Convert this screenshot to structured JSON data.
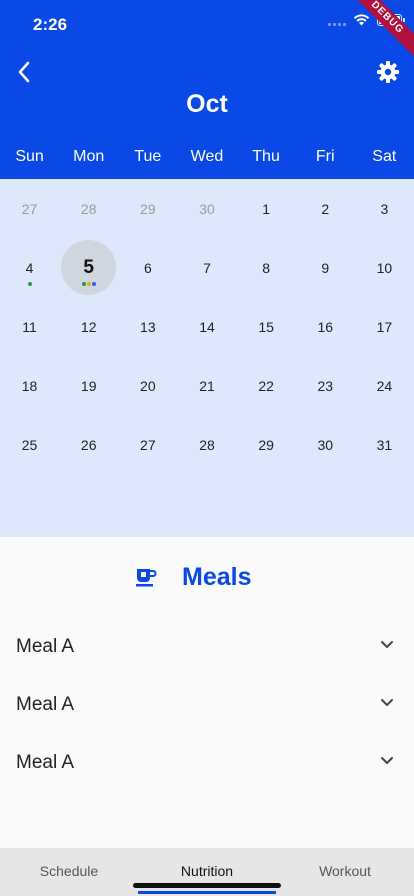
{
  "status_bar": {
    "time": "2:26",
    "debug_label": "DEBUG"
  },
  "header": {
    "month": "Oct"
  },
  "weekdays": [
    "Sun",
    "Mon",
    "Tue",
    "Wed",
    "Thu",
    "Fri",
    "Sat"
  ],
  "calendar": {
    "weeks": [
      [
        {
          "d": "27",
          "muted": true
        },
        {
          "d": "28",
          "muted": true
        },
        {
          "d": "29",
          "muted": true
        },
        {
          "d": "30",
          "muted": true
        },
        {
          "d": "1"
        },
        {
          "d": "2"
        },
        {
          "d": "3"
        }
      ],
      [
        {
          "d": "4",
          "dots": [
            "#1e9e3a"
          ]
        },
        {
          "d": "5",
          "selected": true,
          "dots": [
            "#1e9e3a",
            "#e0b400",
            "#2f5ee8"
          ]
        },
        {
          "d": "6"
        },
        {
          "d": "7"
        },
        {
          "d": "8"
        },
        {
          "d": "9"
        },
        {
          "d": "10"
        }
      ],
      [
        {
          "d": "11"
        },
        {
          "d": "12"
        },
        {
          "d": "13"
        },
        {
          "d": "14"
        },
        {
          "d": "15"
        },
        {
          "d": "16"
        },
        {
          "d": "17"
        }
      ],
      [
        {
          "d": "18"
        },
        {
          "d": "19"
        },
        {
          "d": "20"
        },
        {
          "d": "21"
        },
        {
          "d": "22"
        },
        {
          "d": "23"
        },
        {
          "d": "24"
        }
      ],
      [
        {
          "d": "25"
        },
        {
          "d": "26"
        },
        {
          "d": "27"
        },
        {
          "d": "28"
        },
        {
          "d": "29"
        },
        {
          "d": "30"
        },
        {
          "d": "31"
        }
      ]
    ]
  },
  "meals": {
    "title": "Meals",
    "icon": "cup-icon",
    "items": [
      {
        "label": "Meal A"
      },
      {
        "label": "Meal A"
      },
      {
        "label": "Meal A"
      }
    ]
  },
  "bottom_nav": {
    "tabs": [
      {
        "label": "Schedule"
      },
      {
        "label": "Nutrition",
        "active": true
      },
      {
        "label": "Workout"
      }
    ]
  },
  "colors": {
    "primary": "#0b49e6",
    "calendar_bg": "#dde8fd"
  }
}
